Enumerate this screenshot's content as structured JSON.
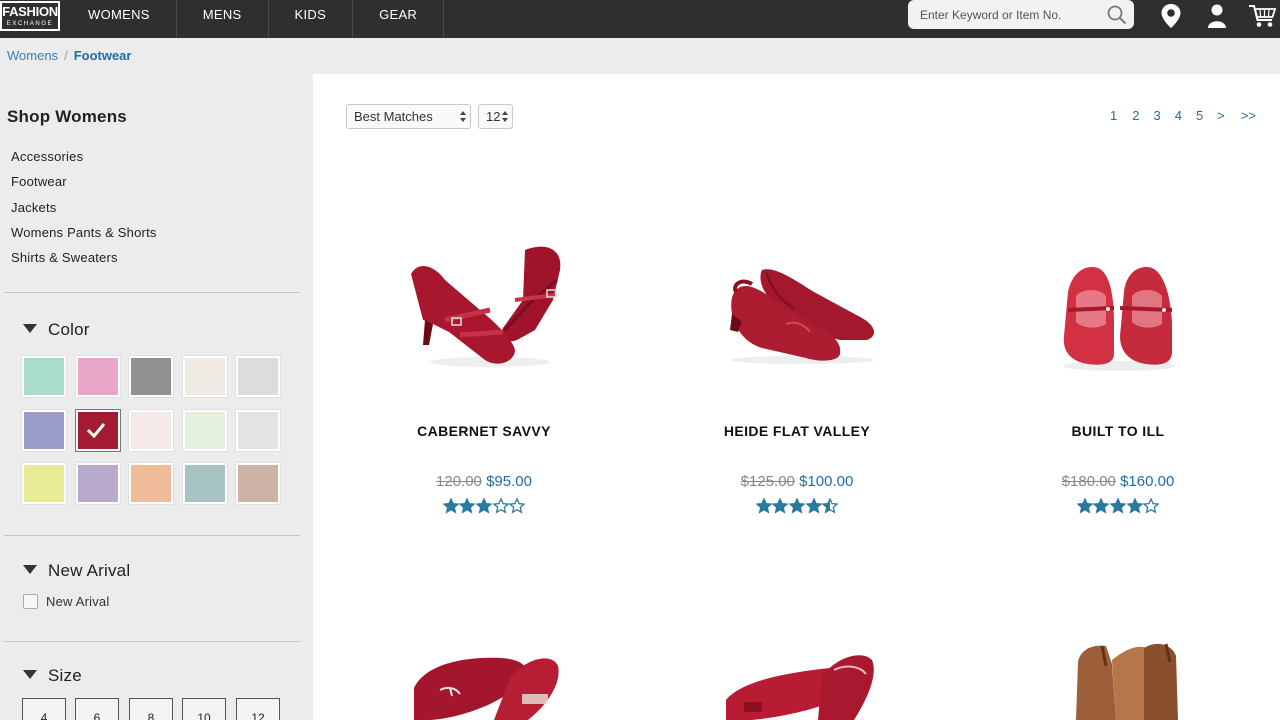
{
  "header": {
    "logo_top": "FASHION",
    "logo_bottom": "EXCHANGE",
    "nav": [
      "WOMENS",
      "MENS",
      "KIDS",
      "GEAR"
    ],
    "search_placeholder": "Enter Keyword or Item No."
  },
  "breadcrumb": {
    "parent": "Womens",
    "separator": "/",
    "current": "Footwear"
  },
  "sidebar": {
    "title": "Shop Womens",
    "categories": [
      "Accessories",
      "Footwear",
      "Jackets",
      "Womens Pants & Shorts",
      "Shirts & Sweaters"
    ],
    "color_label": "Color",
    "swatches": [
      "#a8dccc",
      "#e7a6c7",
      "#919191",
      "#efeae4",
      "#dcdcdc",
      "#9c9cc8",
      "#a31a33",
      "#f4e9e6",
      "#e5f1dc",
      "#e3e3e3",
      "#e9ea94",
      "#b8aacd",
      "#efbb99",
      "#a7c4c2",
      "#cdb2a6"
    ],
    "selected_swatch": 6,
    "new_arrival_label": "New Arival",
    "new_arrival_checkbox": "New Arival",
    "size_label": "Size",
    "sizes": [
      "4",
      "6",
      "8",
      "10",
      "12"
    ]
  },
  "toolbar": {
    "sort": "Best Matches",
    "per_page": "12"
  },
  "pager": [
    "1",
    "2",
    "3",
    "4",
    "5",
    ">",
    ">>"
  ],
  "colors": {
    "accent": "#1f6ea8",
    "star": "#2a7aa0",
    "shoe": "#b0192e"
  },
  "products": [
    {
      "name": "CABERNET SAVVY",
      "old_price": "120.00",
      "price": "$95.00",
      "rating": 3
    },
    {
      "name": "HEIDE FLAT VALLEY",
      "old_price": "$125.00",
      "price": "$100.00",
      "rating": 4.5
    },
    {
      "name": "BUILT TO ILL",
      "old_price": "$180.00",
      "price": "$160.00",
      "rating": 4
    }
  ]
}
